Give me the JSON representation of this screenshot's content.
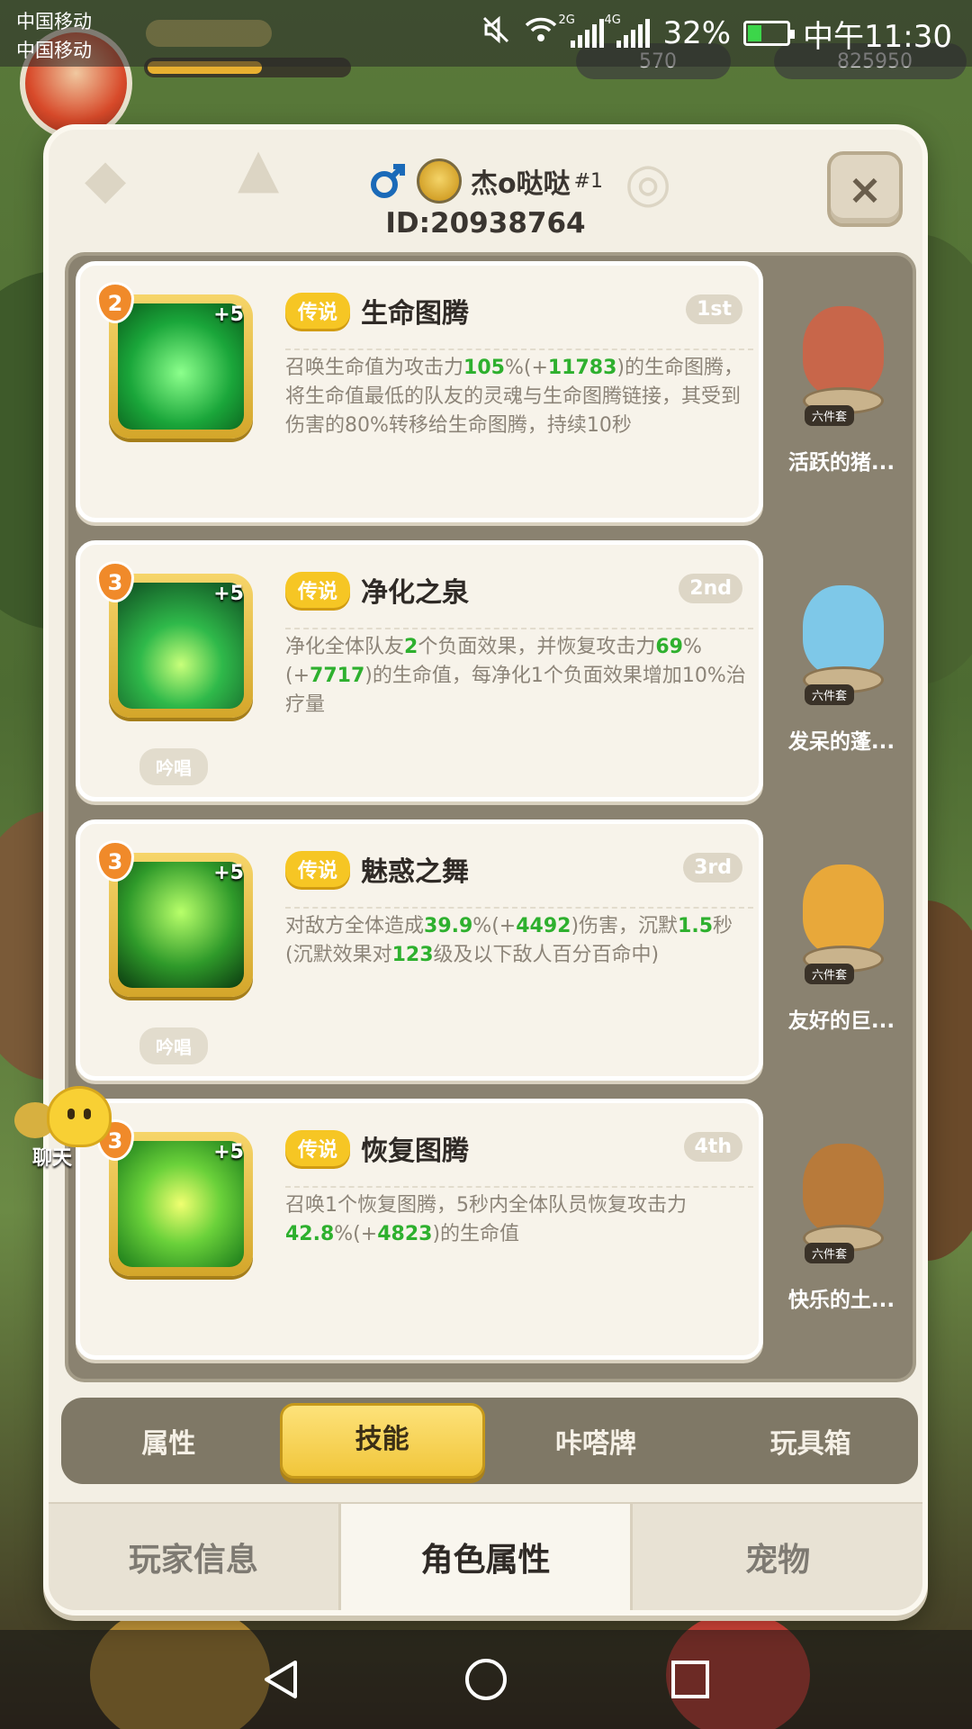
{
  "status_bar": {
    "carrier_1": "中国移动",
    "carrier_2": "中国移动",
    "net_1": "2G",
    "net_2": "4G",
    "battery": "32%",
    "time": "中午11:30"
  },
  "hud": {
    "currency_1": "570",
    "currency_2": "825950"
  },
  "dialog": {
    "player_name": "杰o哒哒",
    "player_suffix": "#1",
    "player_id": "ID:20938764",
    "close_label": "×"
  },
  "skills": [
    {
      "level": "2",
      "plus": "+5",
      "tag": "传说",
      "name": "生命图腾",
      "rank": "1st",
      "desc_parts": [
        "召唤生命值为攻击力",
        "105",
        "%(+",
        "11783",
        ")的生命图腾，将生命值最低的队友的灵魂与生命图腾链接，其受到伤害的80%转移给生命图腾，持续10秒"
      ],
      "chant": "",
      "pet_set": "六件套",
      "pet_name": "活跃的猪..."
    },
    {
      "level": "3",
      "plus": "+5",
      "tag": "传说",
      "name": "净化之泉",
      "rank": "2nd",
      "desc_parts": [
        "净化全体队友",
        "2",
        "个负面效果，并恢复攻击力",
        "69",
        "%(+",
        "7717",
        ")的生命值，每净化1个负面效果增加10%治疗量"
      ],
      "chant": "吟唱",
      "pet_set": "六件套",
      "pet_name": "发呆的蓬..."
    },
    {
      "level": "3",
      "plus": "+5",
      "tag": "传说",
      "name": "魅惑之舞",
      "rank": "3rd",
      "desc_parts": [
        "对敌方全体造成",
        "39.9",
        "%(+",
        "4492",
        ")伤害，沉默",
        "1.5",
        "秒(沉默效果对",
        "123",
        "级及以下敌人百分百命中)"
      ],
      "chant": "吟唱",
      "pet_set": "六件套",
      "pet_name": "友好的巨..."
    },
    {
      "level": "3",
      "plus": "+5",
      "tag": "传说",
      "name": "恢复图腾",
      "rank": "4th",
      "desc_parts": [
        "召唤1个恢复图腾，5秒内全体队员恢复攻击力",
        "42.8",
        "%(+",
        "4823",
        ")的生命值"
      ],
      "chant": "",
      "pet_set": "六件套",
      "pet_name": "快乐的土..."
    }
  ],
  "subtabs": [
    "属性",
    "技能",
    "咔嗒牌",
    "玩具箱"
  ],
  "subtab_active": "技能",
  "bottom_tabs": [
    "玩家信息",
    "角色属性",
    "宠物"
  ],
  "bottom_tab_active": "角色属性",
  "chat": {
    "label": "聊天"
  },
  "colors": {
    "highlight": "#2eb02e",
    "legend": "#f6c624",
    "active_tab": "#f1c63a",
    "panel": "#8a8270"
  }
}
